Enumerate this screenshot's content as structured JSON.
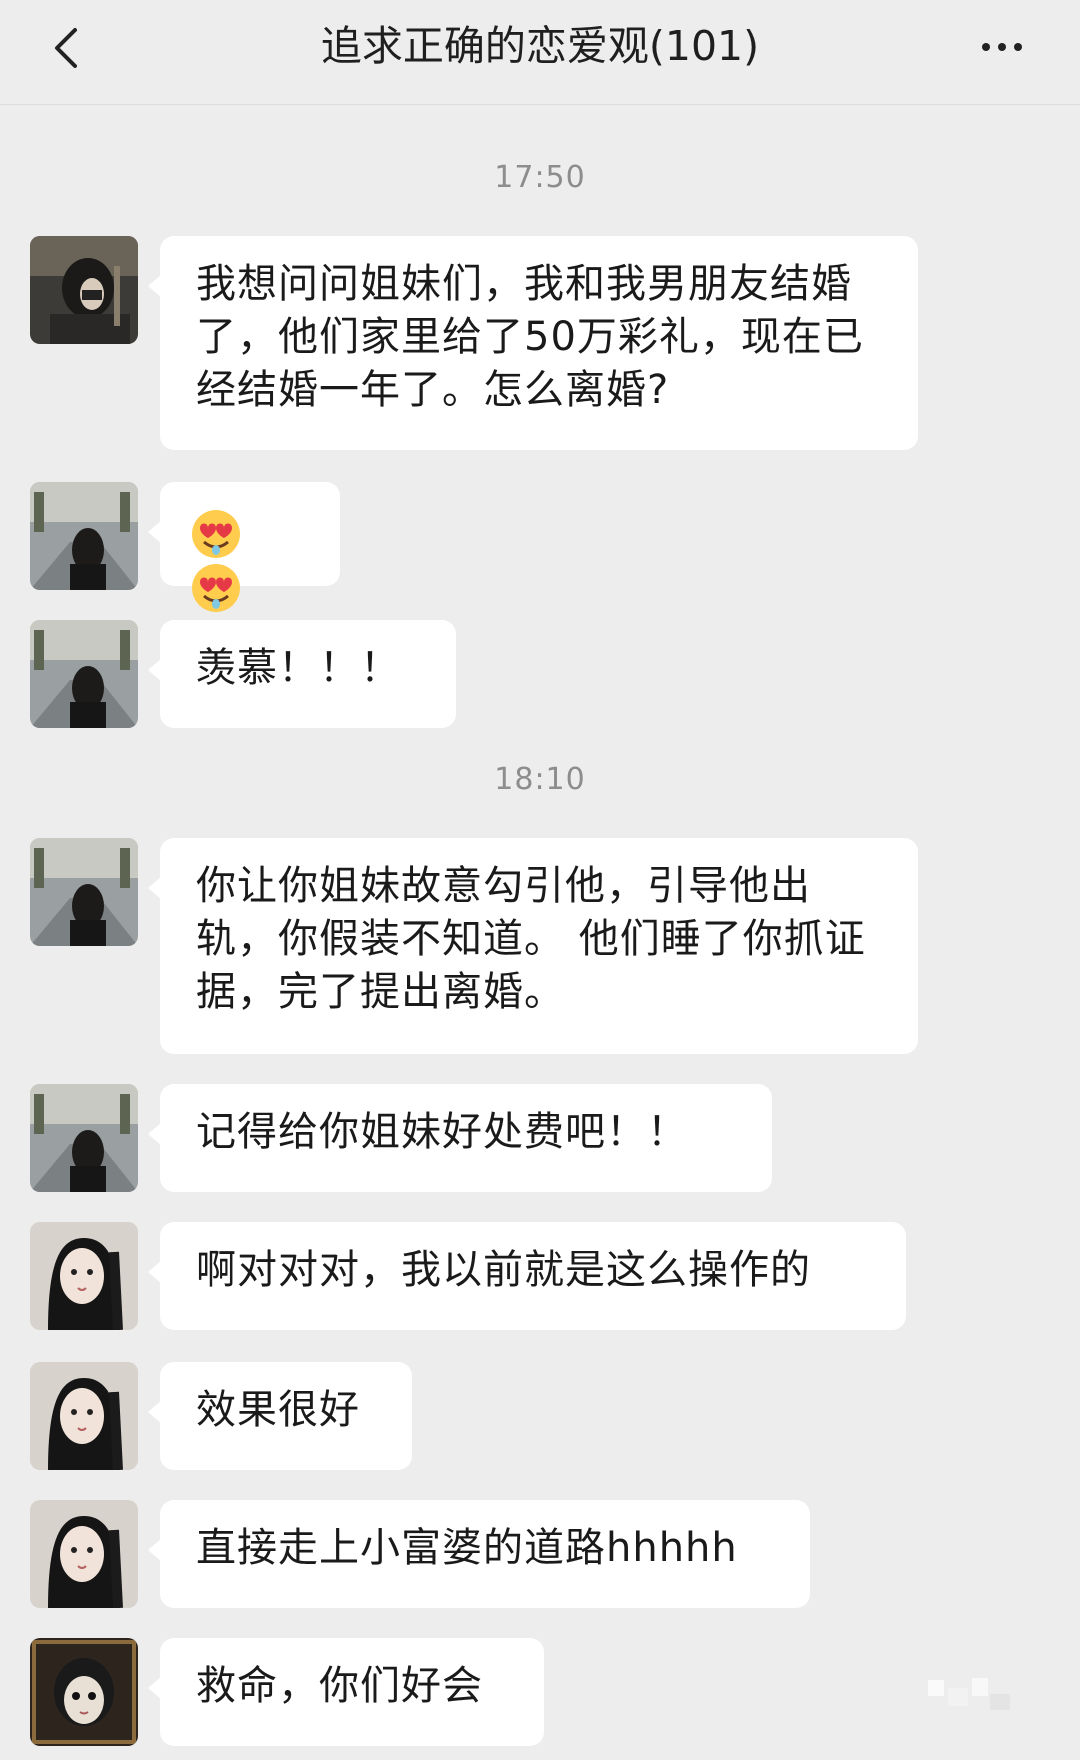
{
  "header": {
    "title": "追求正确的恋爱观(101)",
    "back_icon": "chevron-left-icon",
    "more_icon": "more-icon"
  },
  "timestamps": [
    "17:50",
    "18:10"
  ],
  "messages": [
    {
      "sender": "user-a",
      "text": "我想问问姐妹们，我和我男朋友结婚了，他们家里给了50万彩礼，现在已经结婚一年了。怎么离婚?"
    },
    {
      "sender": "user-b",
      "emoji": "heart-eyes-drool-icon",
      "emoji_count": 2
    },
    {
      "sender": "user-b",
      "text": "羡慕！！！"
    },
    {
      "sender": "user-b",
      "text": "你让你姐妹故意勾引他，引导他出轨，你假装不知道。 他们睡了你抓证据，完了提出离婚。"
    },
    {
      "sender": "user-b",
      "text": "记得给你姐妹好处费吧！！"
    },
    {
      "sender": "user-c",
      "text": "啊对对对，我以前就是这么操作的"
    },
    {
      "sender": "user-c",
      "text": "效果很好"
    },
    {
      "sender": "user-c",
      "text": "直接走上小富婆的道路hhhhh"
    },
    {
      "sender": "user-d",
      "text": "救命，你们好会"
    }
  ],
  "colors": {
    "background": "#ededed",
    "bubble": "#ffffff",
    "timestamp": "#8d8d8d"
  }
}
